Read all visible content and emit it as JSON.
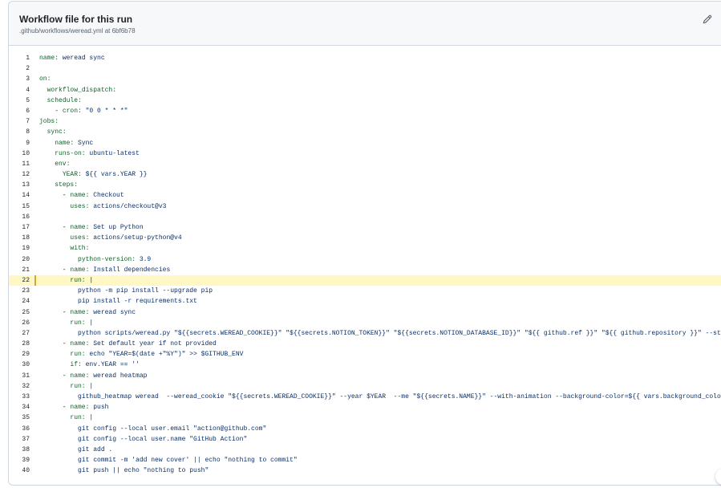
{
  "panel": {
    "title": "Workflow file for this run",
    "subtitle": ".github/workflows/weread.yml at 6bf6b78",
    "edit_icon": "pencil-icon"
  },
  "code": {
    "highlight_line": 22,
    "lines": [
      {
        "n": "1",
        "i": "",
        "k": "name:",
        "v": " weread sync"
      },
      {
        "n": "2",
        "i": "",
        "k": "",
        "v": ""
      },
      {
        "n": "3",
        "i": "",
        "k": "on:",
        "v": ""
      },
      {
        "n": "4",
        "i": "  ",
        "k": "workflow_dispatch:",
        "v": ""
      },
      {
        "n": "5",
        "i": "  ",
        "k": "schedule:",
        "v": ""
      },
      {
        "n": "6",
        "i": "    - ",
        "k": "cron:",
        "v": " \"0 0 * * *\""
      },
      {
        "n": "7",
        "i": "",
        "k": "jobs:",
        "v": ""
      },
      {
        "n": "8",
        "i": "  ",
        "k": "sync:",
        "v": ""
      },
      {
        "n": "9",
        "i": "    ",
        "k": "name:",
        "v": " Sync"
      },
      {
        "n": "10",
        "i": "    ",
        "k": "runs-on:",
        "v": " ubuntu-latest"
      },
      {
        "n": "11",
        "i": "    ",
        "k": "env:",
        "v": ""
      },
      {
        "n": "12",
        "i": "      ",
        "k": "YEAR:",
        "v": " ${{ vars.YEAR }}"
      },
      {
        "n": "13",
        "i": "    ",
        "k": "steps:",
        "v": ""
      },
      {
        "n": "14",
        "i": "      - ",
        "k": "name:",
        "v": " Checkout"
      },
      {
        "n": "15",
        "i": "        ",
        "k": "uses:",
        "v": " actions/checkout@v3"
      },
      {
        "n": "16",
        "i": "",
        "k": "",
        "v": ""
      },
      {
        "n": "17",
        "i": "      - ",
        "k": "name:",
        "v": " Set up Python"
      },
      {
        "n": "18",
        "i": "        ",
        "k": "uses:",
        "v": " actions/setup-python@v4"
      },
      {
        "n": "19",
        "i": "        ",
        "k": "with:",
        "v": ""
      },
      {
        "n": "20",
        "i": "          ",
        "k": "python-version:",
        "v": " 3.9"
      },
      {
        "n": "21",
        "i": "      - ",
        "k": "name:",
        "v": " Install dependencies"
      },
      {
        "n": "22",
        "i": "        ",
        "k": "run:",
        "v": " |"
      },
      {
        "n": "23",
        "i": "          ",
        "k": "",
        "v": "python -m pip install --upgrade pip"
      },
      {
        "n": "24",
        "i": "          ",
        "k": "",
        "v": "pip install -r requirements.txt"
      },
      {
        "n": "25",
        "i": "      - ",
        "k": "name:",
        "v": " weread sync"
      },
      {
        "n": "26",
        "i": "        ",
        "k": "run:",
        "v": " |"
      },
      {
        "n": "27",
        "i": "          ",
        "k": "",
        "v": "python scripts/weread.py \"${{secrets.WEREAD_COOKIE}}\" \"${{secrets.NOTION_TOKEN}}\" \"${{secrets.NOTION_DATABASE_ID}}\" \"${{ github.ref }}\" \"${{ github.repository }}\" --sty"
      },
      {
        "n": "28",
        "i": "      - ",
        "k": "name:",
        "v": " Set default year if not provided"
      },
      {
        "n": "29",
        "i": "        ",
        "k": "run:",
        "v": " echo \"YEAR=$(date +\"%Y\")\" >> $GITHUB_ENV"
      },
      {
        "n": "30",
        "i": "        ",
        "k": "if:",
        "v": " env.YEAR == ''"
      },
      {
        "n": "31",
        "i": "      - ",
        "k": "name:",
        "v": " weread heatmap"
      },
      {
        "n": "32",
        "i": "        ",
        "k": "run:",
        "v": " |"
      },
      {
        "n": "33",
        "i": "          ",
        "k": "",
        "v": "github_heatmap weread  --weread_cookie \"${{secrets.WEREAD_COOKIE}}\" --year $YEAR  --me \"${{secrets.NAME}}\" --with-animation --background-color=${{ vars.background_color"
      },
      {
        "n": "34",
        "i": "      - ",
        "k": "name:",
        "v": " push"
      },
      {
        "n": "35",
        "i": "        ",
        "k": "run:",
        "v": " |"
      },
      {
        "n": "36",
        "i": "          ",
        "k": "",
        "v": "git config --local user.email \"action@github.com\""
      },
      {
        "n": "37",
        "i": "          ",
        "k": "",
        "v": "git config --local user.name \"GitHub Action\""
      },
      {
        "n": "38",
        "i": "          ",
        "k": "",
        "v": "git add ."
      },
      {
        "n": "39",
        "i": "          ",
        "k": "",
        "v": "git commit -m 'add new cover' || echo \"nothing to commit\""
      },
      {
        "n": "40",
        "i": "          ",
        "k": "",
        "v": "git push || echo \"nothing to push\""
      }
    ]
  }
}
